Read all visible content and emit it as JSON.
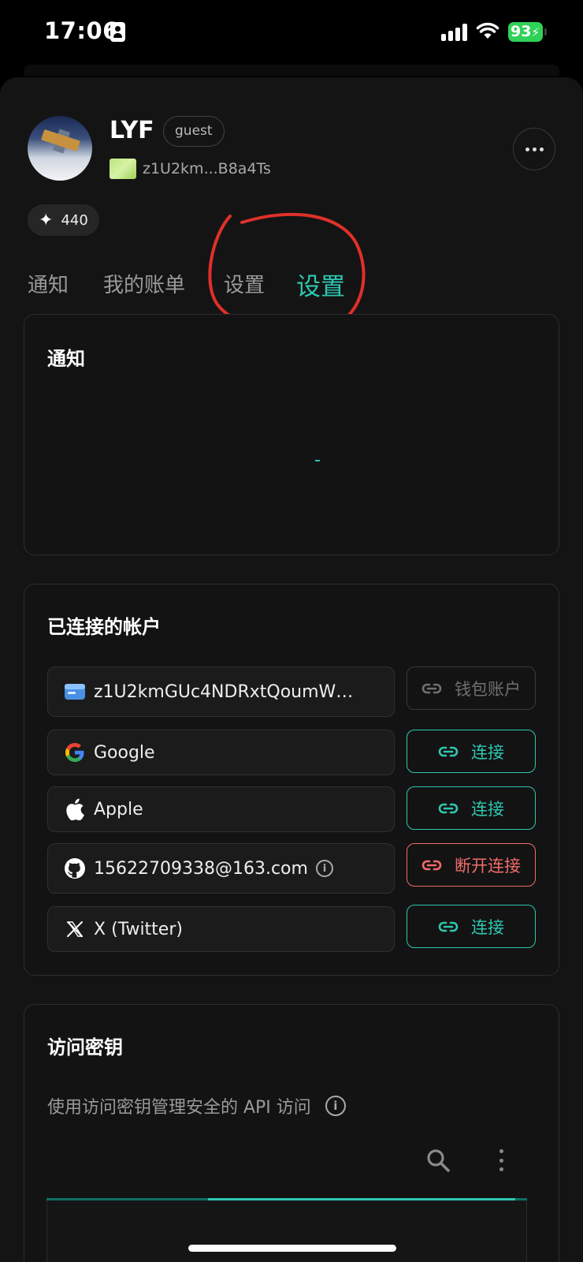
{
  "status_bar": {
    "time": "17:06",
    "battery": "93",
    "battery_color": "#30d158"
  },
  "profile": {
    "name": "LYF",
    "role_badge": "guest",
    "wallet_address_short": "z1U2km...B8a4Ts",
    "points": "440",
    "points_icon": "sparkle-icon",
    "more_icon": "more-horizontal-icon"
  },
  "tabs": [
    {
      "label": "通知",
      "active": false
    },
    {
      "label": "我的账单",
      "active": false
    },
    {
      "label": "设置",
      "active": false
    },
    {
      "label": "设置",
      "active": true
    }
  ],
  "notifications_card": {
    "title": "通知",
    "empty_placeholder": "-"
  },
  "connected_accounts": {
    "title": "已连接的帐户",
    "rows": [
      {
        "icon": "wallet-icon",
        "label": "z1U2kmGUc4NDRxtQoumWB...",
        "action": "钱包账户",
        "action_state": "disabled"
      },
      {
        "icon": "google-icon",
        "label": "Google",
        "action": "连接",
        "action_state": "connect"
      },
      {
        "icon": "apple-icon",
        "label": "Apple",
        "action": "连接",
        "action_state": "connect"
      },
      {
        "icon": "github-icon",
        "label": "15622709338@163.com",
        "action": "断开连接",
        "action_state": "disconnect"
      },
      {
        "icon": "x-twitter-icon",
        "label": "X (Twitter)",
        "action": "连接",
        "action_state": "connect"
      }
    ]
  },
  "access_keys": {
    "title": "访问密钥",
    "description": "使用访问密钥管理安全的 API 访问",
    "search_icon": "search-icon",
    "menu_icon": "more-vertical-icon"
  },
  "colors": {
    "accent": "#2ec7b0",
    "danger": "#f26b6b",
    "annotation": "#e0302a",
    "background": "#141414"
  }
}
